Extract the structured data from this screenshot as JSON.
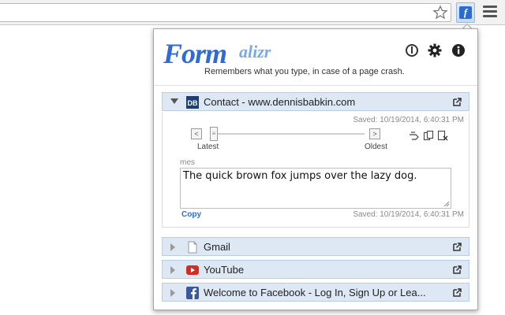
{
  "browser": {
    "star_icon": "star-icon",
    "extension_icon": "formalizr-extension-icon",
    "extension_glyph": "f",
    "menu_icon": "hamburger-menu-icon"
  },
  "popup": {
    "logo": {
      "part1": "Form",
      "part2": "alizr"
    },
    "tagline": "Remembers what you type, in case of a page crash.",
    "header_icons": [
      "power-icon",
      "gear-icon",
      "info-icon"
    ],
    "accent_color": "#2f6bd3",
    "section_bg_color": "#dde8f4"
  },
  "sites": [
    {
      "title": "Contact - www.dennisbabkin.com",
      "favicon": "db-favicon",
      "expanded": true,
      "saved_top": "Saved: 10/19/2014, 6:40:31 PM",
      "nav_prev": "<",
      "nav_next": ">",
      "slider_latest": "Latest",
      "slider_oldest": "Oldest",
      "field_name": "mes",
      "field_text": "The quick brown fox jumps over the lazy dog.",
      "copy_label": "Copy",
      "saved_bottom": "Saved: 10/19/2014, 6:40:31 PM"
    },
    {
      "title": "Gmail",
      "favicon": "page-icon",
      "expanded": false
    },
    {
      "title": "YouTube",
      "favicon": "youtube-icon",
      "expanded": false
    },
    {
      "title": "Welcome to Facebook - Log In, Sign Up or Lea...",
      "favicon": "facebook-icon",
      "expanded": false
    }
  ]
}
